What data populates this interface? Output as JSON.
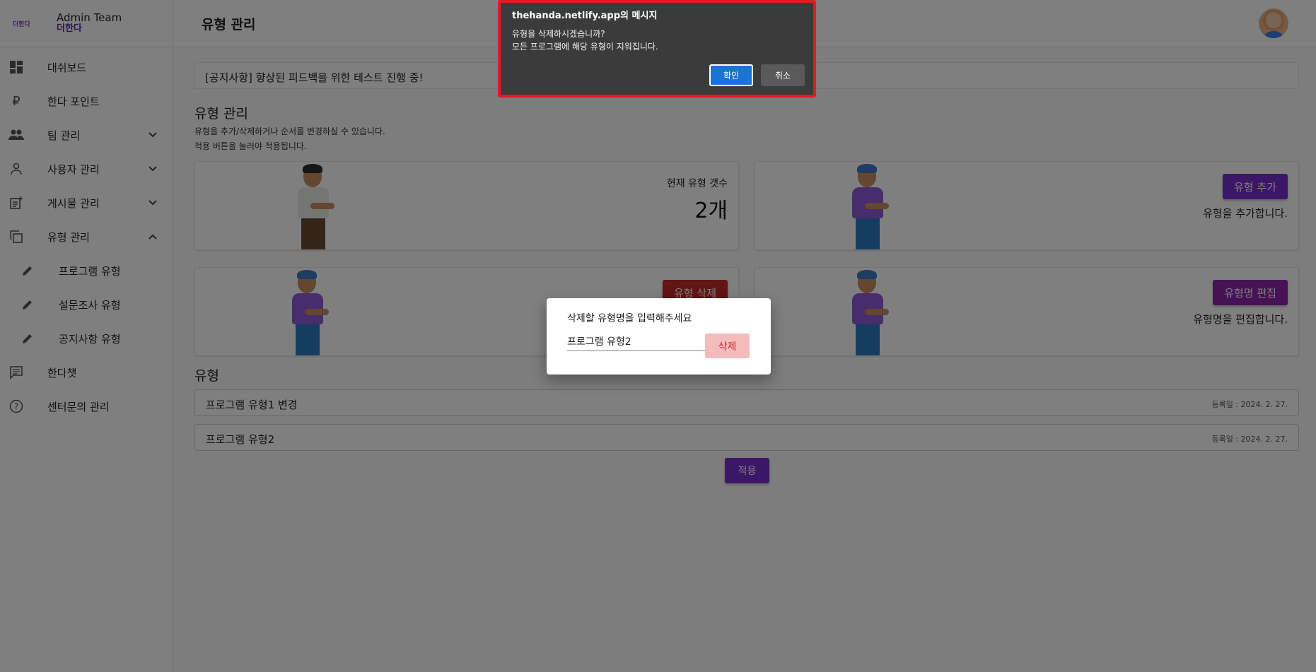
{
  "brand": {
    "logo_text": "더한다",
    "title": "Admin Team",
    "subtitle": "더한다"
  },
  "header": {
    "title": "유형 관리"
  },
  "sidebar": {
    "items": [
      {
        "label": "대쉬보드",
        "icon": "dashboard-icon"
      },
      {
        "label": "한다 포인트",
        "icon": "ruble-icon"
      },
      {
        "label": "팀 관리",
        "icon": "group-icon"
      },
      {
        "label": "사용자 관리",
        "icon": "person-icon"
      },
      {
        "label": "게시물 관리",
        "icon": "post-add-icon"
      },
      {
        "label": "유형 관리",
        "icon": "copy-icon"
      },
      {
        "label": "프로그램 유형",
        "icon": "pencil-icon"
      },
      {
        "label": "설문조사 유형",
        "icon": "pencil-icon"
      },
      {
        "label": "공지사항 유형",
        "icon": "pencil-icon"
      },
      {
        "label": "한다챗",
        "icon": "chat-icon"
      },
      {
        "label": "센터문의 관리",
        "icon": "help-icon"
      }
    ]
  },
  "main": {
    "notice": "[공지사항] 향상된 피드백을 위한 테스트 진행 중!",
    "section_title": "유형 관리",
    "description_line1": "유형을 추가/삭제하거나 순서를 변경하실 수 있습니다.",
    "description_line2": "적용 버튼을 눌러야 적용됩니다.",
    "count_card": {
      "label": "현재 유형 갯수",
      "value": "2개"
    },
    "add_card": {
      "button": "유형 추가",
      "desc": "유형을 추가합니다."
    },
    "delete_card": {
      "button": "유형 삭제"
    },
    "edit_card": {
      "button": "유형명 편집",
      "desc": "유형명을 편집합니다."
    },
    "list_title": "유형",
    "types": [
      {
        "name": "프로그램 유형1 변경",
        "date": "등록일 : 2024. 2. 27."
      },
      {
        "name": "프로그램 유형2",
        "date": "등록일 : 2024. 2. 27."
      }
    ],
    "apply_button": "적용"
  },
  "dialog": {
    "label": "삭제할 유형명을 입력해주세요",
    "input_value": "프로그램 유형2",
    "delete_button": "삭제"
  },
  "alert": {
    "title": "thehanda.netlify.app의 메시지",
    "line1": "유형을 삭제하시겠습니까?",
    "line2": "모든 프로그램에 해당 유형이 지워집니다.",
    "ok": "확인",
    "cancel": "취소"
  },
  "colors": {
    "accent": "#7b2fcf",
    "danger": "#c62828",
    "alert_border": "#e01b24"
  }
}
